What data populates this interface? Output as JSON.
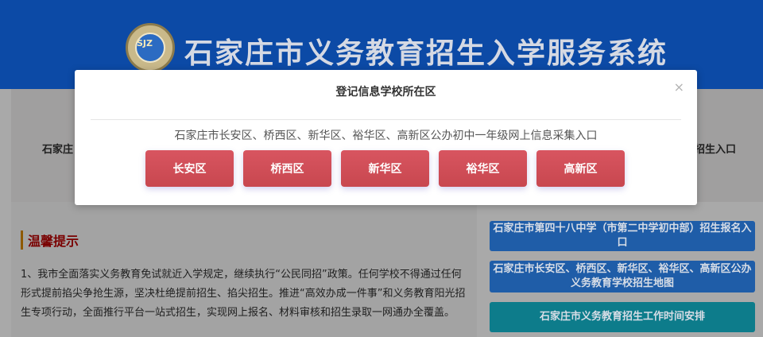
{
  "header": {
    "site_title": "石家庄市义务教育招生入学服务系统",
    "logo_mark": "SJZ"
  },
  "cards": {
    "left_link_text": "石家庄",
    "right_link_text": "招生入口"
  },
  "tips": {
    "title": "温馨提示",
    "body": "1、我市全面落实义务教育免试就近入学规定，继续执行“公民同招”政策。任何学校不得通过任何形式提前掐尖争抢生源，坚决杜绝提前招生、掐尖招生。推进“高效办成一件事”和义务教育阳光招生专项行动，全面推行平台一站式招生，实现网上报名、材料审核和招生录取一网通办全覆盖。"
  },
  "side_links": [
    {
      "label": "石家庄市第四十八中学（市第二中学初中部）招生报名入口"
    },
    {
      "label": "石家庄市长安区、桥西区、新华区、裕华区、高新区公办义务教育学校招生地图"
    },
    {
      "label": "石家庄市义务教育招生工作时间安排"
    }
  ],
  "modal": {
    "title": "登记信息学校所在区",
    "close_symbol": "×",
    "subtitle": "石家庄市长安区、桥西区、新华区、裕华区、高新区公办初中一年级网上信息采集入口",
    "districts": [
      {
        "label": "长安区"
      },
      {
        "label": "桥西区"
      },
      {
        "label": "新华区"
      },
      {
        "label": "裕华区"
      },
      {
        "label": "高新区"
      }
    ]
  },
  "colors": {
    "banner": "#0c4aa6",
    "district_button": "#d04d56",
    "side_button_blue": "#1f5da8",
    "side_button_teal": "#0d7c8b"
  }
}
